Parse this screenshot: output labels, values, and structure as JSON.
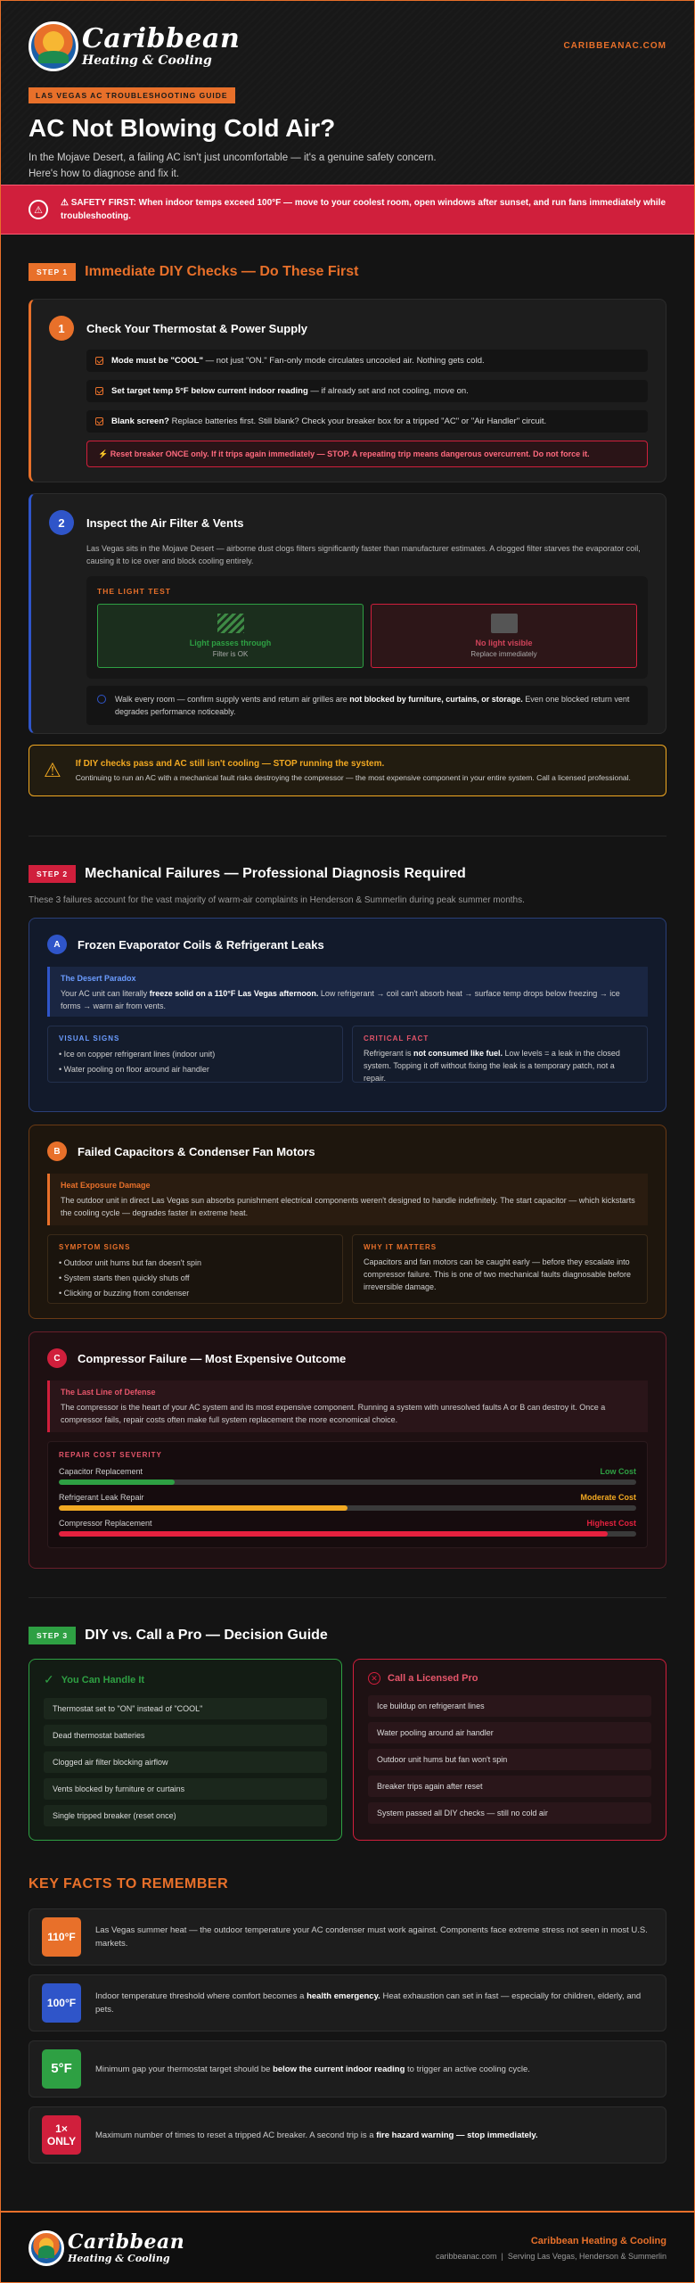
{
  "header": {
    "logo_name": "Caribbean",
    "logo_sub": "Heating & Cooling",
    "site": "CARIBBEANAC.COM",
    "tag": "LAS VEGAS AC TROUBLESHOOTING GUIDE",
    "title": "AC Not Blowing Cold Air?",
    "intro": "In the Mojave Desert, a failing AC isn't just uncomfortable — it's a genuine safety concern. Here's how to diagnose and fix it."
  },
  "safety": {
    "text": "⚠ SAFETY FIRST: When indoor temps exceed 100°F — move to your coolest room, open windows after sunset, and run fans immediately while troubleshooting."
  },
  "step1": {
    "badge": "STEP 1",
    "title": "Immediate DIY Checks — Do These First",
    "card1": {
      "num": "1",
      "title": "Check Your Thermostat & Power Supply",
      "items": [
        {
          "bold": "Mode must be \"COOL\"",
          "rest": " — not just \"ON.\" Fan-only mode circulates uncooled air. Nothing gets cold."
        },
        {
          "bold": "Set target temp 5°F below current indoor reading",
          "rest": " — if already set and not cooling, move on."
        },
        {
          "bold": "Blank screen?",
          "rest": " Replace batteries first. Still blank? Check your breaker box for a tripped \"AC\" or \"Air Handler\" circuit."
        }
      ],
      "warning": "⚡ Reset breaker ONCE only. If it trips again immediately — STOP. A repeating trip means dangerous overcurrent. Do not force it."
    },
    "card2": {
      "num": "2",
      "title": "Inspect the Air Filter & Vents",
      "text": "Las Vegas sits in the Mojave Desert — airborne dust clogs filters significantly faster than manufacturer estimates. A clogged filter starves the evaporator coil, causing it to ice over and block cooling entirely.",
      "light_label": "THE LIGHT TEST",
      "ok_title": "Light passes through",
      "ok_sub": "Filter is OK",
      "bad_title": "No light visible",
      "bad_sub": "Replace immediately",
      "vent_pre": "Walk every room — confirm supply vents and return air grilles are ",
      "vent_bold": "not blocked by furniture, curtains, or storage.",
      "vent_post": " Even one blocked return vent degrades performance noticeably."
    },
    "stop": {
      "title": "If DIY checks pass and AC still isn't cooling — STOP running the system.",
      "text": "Continuing to run an AC with a mechanical fault risks destroying the compressor — the most expensive component in your entire system. Call a licensed professional."
    }
  },
  "step2": {
    "badge": "STEP 2",
    "title": "Mechanical Failures — Professional Diagnosis Required",
    "sub": "These 3 failures account for the vast majority of warm-air complaints in Henderson & Summerlin during peak summer months.",
    "a": {
      "letter": "A",
      "title": "Frozen Evaporator Coils & Refrigerant Leaks",
      "callout_title": "The Desert Paradox",
      "callout_pre": "Your AC unit can literally ",
      "callout_bold": "freeze solid on a 110°F Las Vegas afternoon.",
      "callout_post": " Low refrigerant → coil can't absorb heat → surface temp drops below freezing → ice forms → warm air from vents.",
      "visual_label": "VISUAL SIGNS",
      "visual_items": [
        "Ice on copper refrigerant lines (indoor unit)",
        "Water pooling on floor around air handler"
      ],
      "fact_label": "CRITICAL FACT",
      "fact_pre": "Refrigerant is ",
      "fact_bold": "not consumed like fuel.",
      "fact_post": " Low levels = a leak in the closed system. Topping it off without fixing the leak is a temporary patch, not a repair."
    },
    "b": {
      "letter": "B",
      "title": "Failed Capacitors & Condenser Fan Motors",
      "callout_title": "Heat Exposure Damage",
      "callout_text": "The outdoor unit in direct Las Vegas sun absorbs punishment electrical components weren't designed to handle indefinitely. The start capacitor — which kickstarts the cooling cycle — degrades faster in extreme heat.",
      "symptom_label": "SYMPTOM SIGNS",
      "symptom_items": [
        "Outdoor unit hums but fan doesn't spin",
        "System starts then quickly shuts off",
        "Clicking or buzzing from condenser"
      ],
      "why_label": "WHY IT MATTERS",
      "why_text": "Capacitors and fan motors can be caught early — before they escalate into compressor failure. This is one of two mechanical faults diagnosable before irreversible damage."
    },
    "c": {
      "letter": "C",
      "title": "Compressor Failure — Most Expensive Outcome",
      "callout_title": "The Last Line of Defense",
      "callout_text": "The compressor is the heart of your AC system and its most expensive component. Running a system with unresolved faults A or B can destroy it. Once a compressor fails, repair costs often make full system replacement the more economical choice.",
      "severity_label": "REPAIR COST SEVERITY",
      "bars": [
        {
          "name": "Capacitor Replacement",
          "level": "Low Cost",
          "fraction": 0.2,
          "color": "#2ea043"
        },
        {
          "name": "Refrigerant Leak Repair",
          "level": "Moderate Cost",
          "fraction": 0.5,
          "color": "#f2a922"
        },
        {
          "name": "Compressor Replacement",
          "level": "Highest Cost",
          "fraction": 0.95,
          "color": "#e5213f"
        }
      ]
    }
  },
  "step3": {
    "badge": "STEP 3",
    "title": "DIY vs. Call a Pro — Decision Guide",
    "diy_title": "You Can Handle It",
    "diy_items": [
      "Thermostat set to \"ON\" instead of \"COOL\"",
      "Dead thermostat batteries",
      "Clogged air filter blocking airflow",
      "Vents blocked by furniture or curtains",
      "Single tripped breaker (reset once)"
    ],
    "pro_title": "Call a Licensed Pro",
    "pro_items": [
      "Ice buildup on refrigerant lines",
      "Water pooling around air handler",
      "Outdoor unit hums but fan won't spin",
      "Breaker trips again after reset",
      "System passed all DIY checks — still no cold air"
    ]
  },
  "facts": {
    "title": "KEY FACTS TO REMEMBER",
    "items": [
      {
        "badge": "110°F",
        "color": "#e8702a",
        "pre": "Las Vegas summer heat — the outdoor temperature your AC condenser must work against. Components face extreme stress not seen in most U.S. markets.",
        "bold": "",
        "post": ""
      },
      {
        "badge": "100°F",
        "color": "#2f55c9",
        "pre": "Indoor temperature threshold where comfort becomes a ",
        "bold": "health emergency.",
        "post": " Heat exhaustion can set in fast — especially for children, elderly, and pets."
      },
      {
        "badge": "5°F",
        "color": "#2ea043",
        "pre": "Minimum gap your thermostat target should be ",
        "bold": "below the current indoor reading",
        "post": " to trigger an active cooling cycle."
      },
      {
        "badge": "1× ONLY",
        "color": "#d01f3c",
        "pre": "Maximum number of times to reset a tripped AC breaker. A second trip is a ",
        "bold": "fire hazard warning — stop immediately.",
        "post": ""
      }
    ]
  },
  "footer": {
    "company": "Caribbean Heating & Cooling",
    "meta": "caribbeanac.com  |  Serving Las Vegas, Henderson & Summerlin"
  }
}
